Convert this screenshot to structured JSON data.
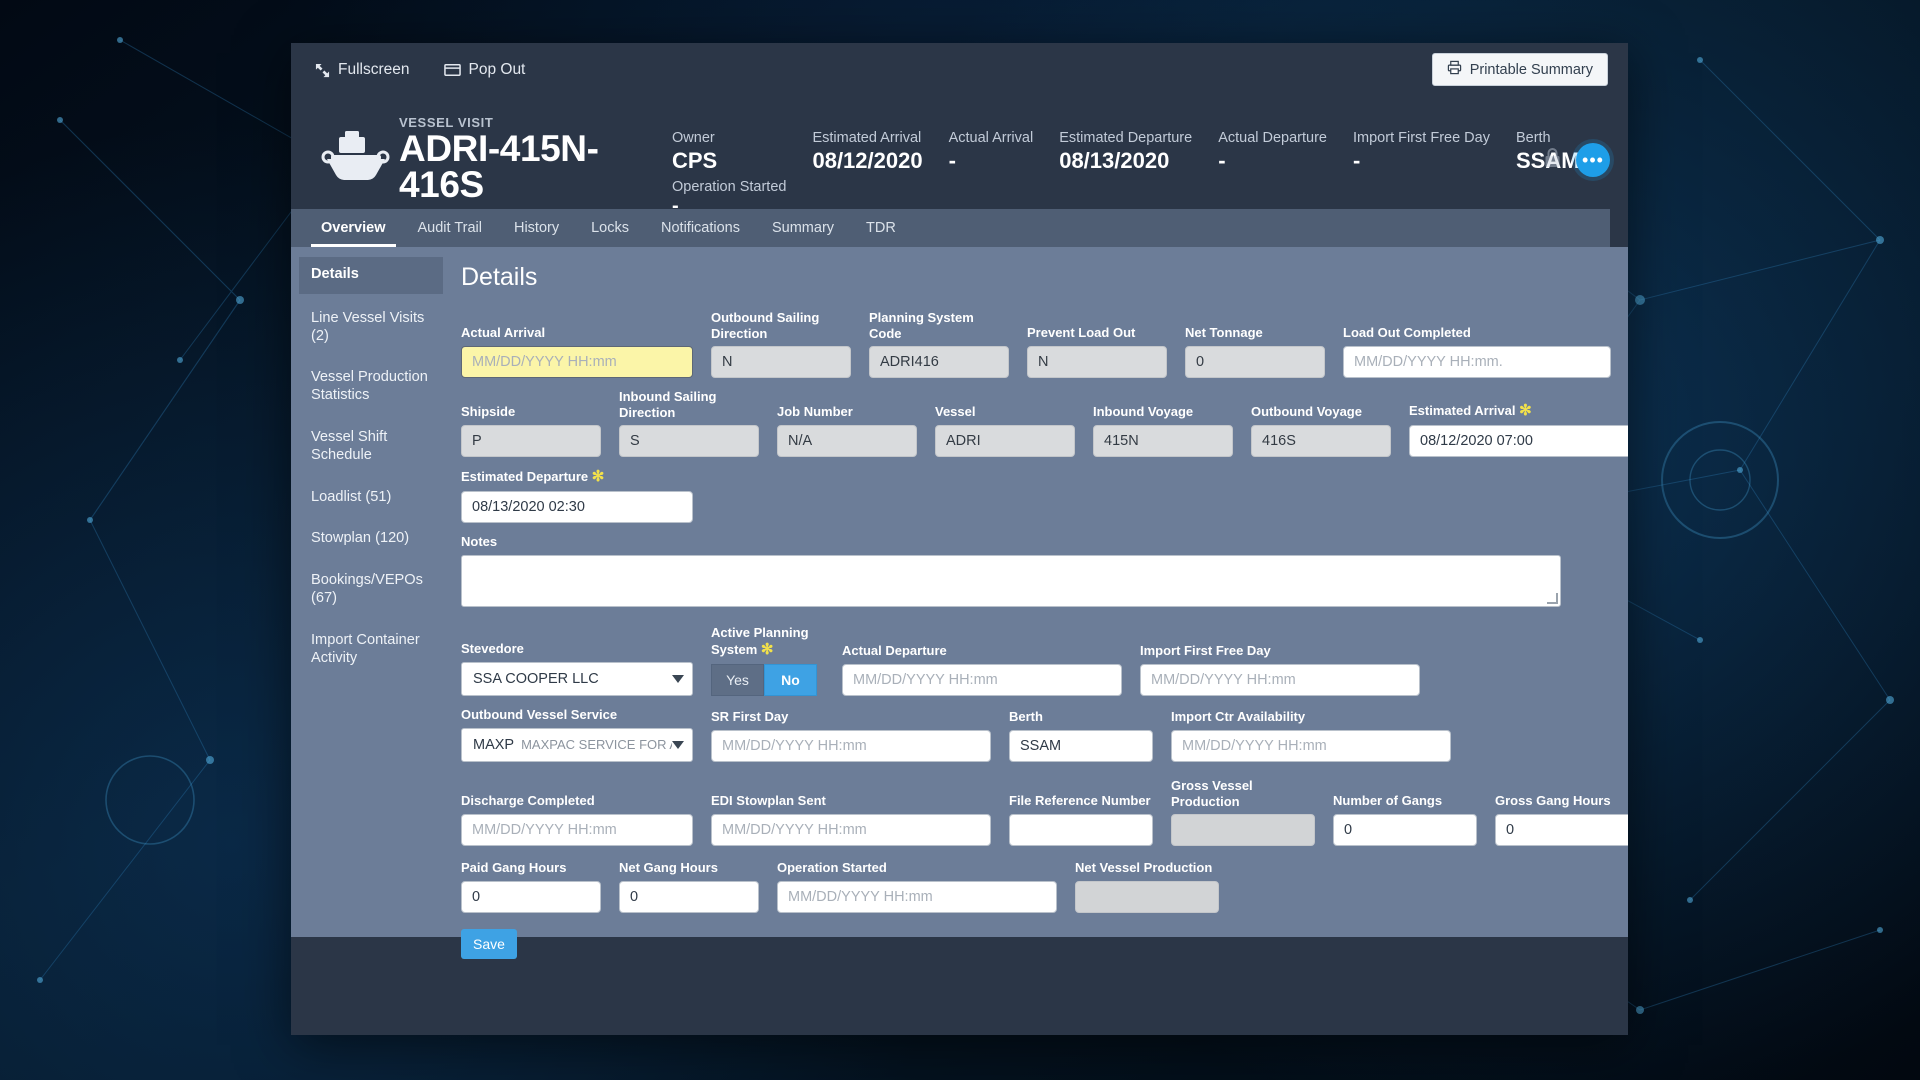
{
  "utilbar": {
    "fullscreen": "Fullscreen",
    "popout": "Pop Out",
    "printable_summary": "Printable Summary"
  },
  "vessel": {
    "kicker": "VESSEL VISIT",
    "name": "ADRI-415N-416S",
    "stats": [
      {
        "label": "Owner",
        "value": "CPS",
        "label2": "Operation Started",
        "value2": "-"
      },
      {
        "label": "Estimated Arrival",
        "value": "08/12/2020"
      },
      {
        "label": "Actual Arrival",
        "value": "-"
      },
      {
        "label": "Estimated Departure",
        "value": "08/13/2020"
      },
      {
        "label": "Actual Departure",
        "value": "-"
      },
      {
        "label": "Import First Free Day",
        "value": "-"
      },
      {
        "label": "Berth",
        "value": "SSAM"
      }
    ],
    "more_label": "•••"
  },
  "tabs": [
    {
      "label": "Overview",
      "active": true
    },
    {
      "label": "Audit Trail",
      "active": false
    },
    {
      "label": "History",
      "active": false
    },
    {
      "label": "Locks",
      "active": false
    },
    {
      "label": "Notifications",
      "active": false
    },
    {
      "label": "Summary",
      "active": false
    },
    {
      "label": "TDR",
      "active": false
    }
  ],
  "sidebar": {
    "items": [
      {
        "label": "Details",
        "active": true
      },
      {
        "label": "Line Vessel Visits (2)",
        "active": false
      },
      {
        "label": "Vessel Production Statistics",
        "active": false
      },
      {
        "label": "Vessel Shift Schedule",
        "active": false
      },
      {
        "label": "Loadlist (51)",
        "active": false
      },
      {
        "label": "Stowplan (120)",
        "active": false
      },
      {
        "label": "Bookings/VEPOs (67)",
        "active": false
      },
      {
        "label": "Import Container Activity",
        "active": false
      }
    ]
  },
  "details": {
    "heading": "Details",
    "row1": {
      "actual_arrival_label": "Actual Arrival",
      "actual_arrival_placeholder": "MM/DD/YYYY HH:mm",
      "outbound_sailing_direction_label": "Outbound Sailing\nDirection",
      "outbound_sailing_direction_value": "N",
      "planning_system_code_label": "Planning System Code",
      "planning_system_code_value": "ADRI416",
      "prevent_load_out_label": "Prevent Load Out",
      "prevent_load_out_value": "N",
      "net_tonnage_label": "Net Tonnage",
      "net_tonnage_value": "0",
      "load_out_completed_label": "Load Out Completed",
      "load_out_completed_placeholder": "MM/DD/YYYY HH:mm."
    },
    "row2": {
      "shipside_label": "Shipside",
      "shipside_value": "P",
      "inbound_sailing_direction_label": "Inbound Sailing\nDirection",
      "inbound_sailing_direction_value": "S",
      "job_number_label": "Job Number",
      "job_number_value": "N/A",
      "vessel_label": "Vessel",
      "vessel_value": "ADRI",
      "inbound_voyage_label": "Inbound Voyage",
      "inbound_voyage_value": "415N",
      "outbound_voyage_label": "Outbound Voyage",
      "outbound_voyage_value": "416S",
      "estimated_arrival_label": "Estimated Arrival",
      "estimated_arrival_value": "08/12/2020 07:00"
    },
    "row3": {
      "estimated_departure_label": "Estimated Departure",
      "estimated_departure_value": "08/13/2020 02:30"
    },
    "notes_label": "Notes",
    "notes_value": "",
    "row4": {
      "stevedore_label": "Stevedore",
      "stevedore_value": "SSA COOPER LLC",
      "active_planning_system_label": "Active Planning\nSystem",
      "active_planning_yes": "Yes",
      "active_planning_no": "No",
      "actual_departure_label": "Actual Departure",
      "actual_departure_placeholder": "MM/DD/YYYY HH:mm",
      "import_first_free_day_label": "Import First Free Day",
      "import_first_free_day_placeholder": "MM/DD/YYYY HH:mm"
    },
    "row5": {
      "outbound_vessel_service_label": "Outbound Vessel Service",
      "outbound_vessel_service_code": "MAXP",
      "outbound_vessel_service_desc": "MAXPAC SERVICE FOR ANZ",
      "sr_first_day_label": "SR First Day",
      "sr_first_day_placeholder": "MM/DD/YYYY HH:mm",
      "berth_label": "Berth",
      "berth_value": "SSAM",
      "import_ctr_availability_label": "Import Ctr Availability",
      "import_ctr_availability_placeholder": "MM/DD/YYYY HH:mm"
    },
    "row6": {
      "discharge_completed_label": "Discharge Completed",
      "discharge_completed_placeholder": "MM/DD/YYYY HH:mm",
      "edi_stowplan_sent_label": "EDI Stowplan Sent",
      "edi_stowplan_sent_placeholder": "MM/DD/YYYY HH:mm",
      "file_reference_number_label": "File Reference Number",
      "file_reference_number_value": "",
      "gross_vessel_production_label": "Gross Vessel\nProduction",
      "gross_vessel_production_value": "",
      "number_of_gangs_label": "Number of Gangs",
      "number_of_gangs_value": "0",
      "gross_gang_hours_label": "Gross Gang Hours",
      "gross_gang_hours_value": "0"
    },
    "row7": {
      "paid_gang_hours_label": "Paid Gang Hours",
      "paid_gang_hours_value": "0",
      "net_gang_hours_label": "Net Gang Hours",
      "net_gang_hours_value": "0",
      "operation_started_label": "Operation Started",
      "operation_started_placeholder": "MM/DD/YYYY HH:mm",
      "net_vessel_production_label": "Net Vessel Production",
      "net_vessel_production_value": ""
    },
    "save_label": "Save"
  },
  "colors": {
    "accent": "#3ea2e4",
    "required_star": "#f2e14a",
    "header_bg": "#2b3647",
    "body_bg": "#6c7d98",
    "highlight_field": "#fbf5a8"
  }
}
